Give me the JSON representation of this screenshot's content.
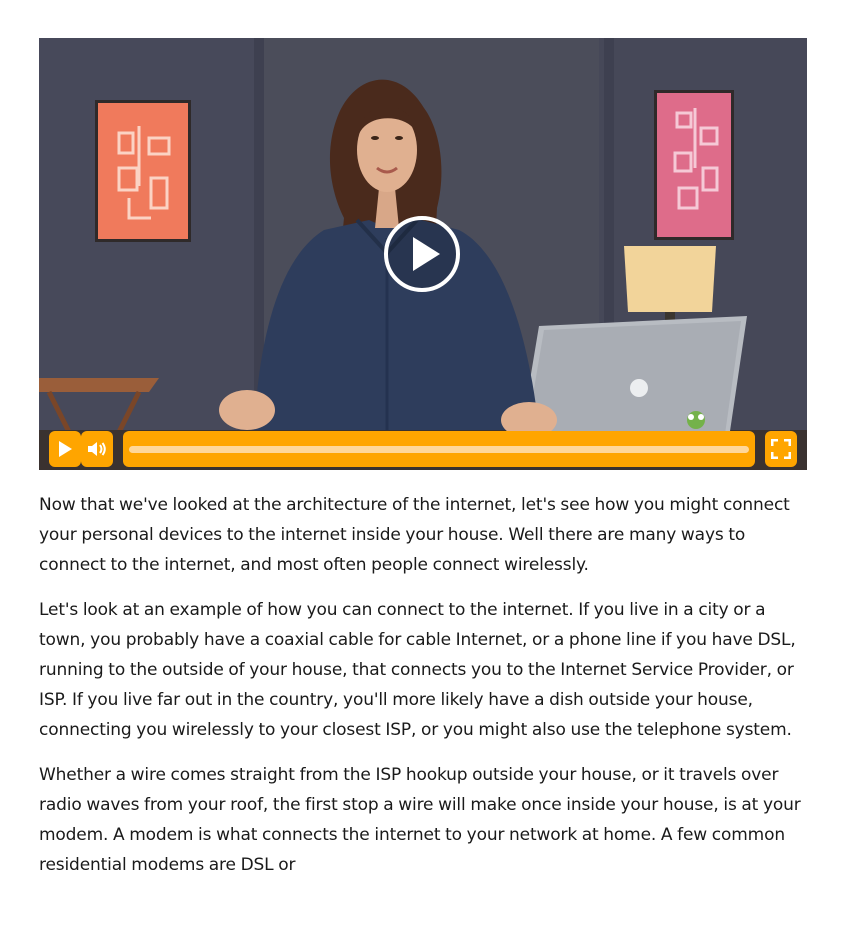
{
  "video": {
    "player_name": "lesson-video",
    "progress": 0,
    "accent_color": "#ffa500",
    "controls": {
      "play_icon": "play-icon",
      "volume_icon": "volume-icon",
      "fullscreen_icon": "fullscreen-icon",
      "big_play_icon": "play-circle-icon"
    }
  },
  "transcript": {
    "paragraphs": [
      "Now that we've looked at the architecture of the internet, let's see how you might connect your personal devices to the internet inside your house. Well there are many ways to connect to the internet, and most often people connect wirelessly.",
      "Let's look at an example of how you can connect to the internet. If you live in a city or a town, you probably have a coaxial cable for cable Internet, or a phone line if you have DSL, running to the outside of your house, that connects you to the Internet Service Provider, or ISP. If you live far out in the country, you'll more likely have a dish outside your house, connecting you wirelessly to your closest ISP, or you might also use the telephone system.",
      "Whether a wire comes straight from the ISP hookup outside your house, or it travels over radio waves from your roof, the first stop a wire will make once inside your house, is at your modem. A modem is what connects the internet to your network at home. A few common residential modems are DSL or"
    ]
  }
}
